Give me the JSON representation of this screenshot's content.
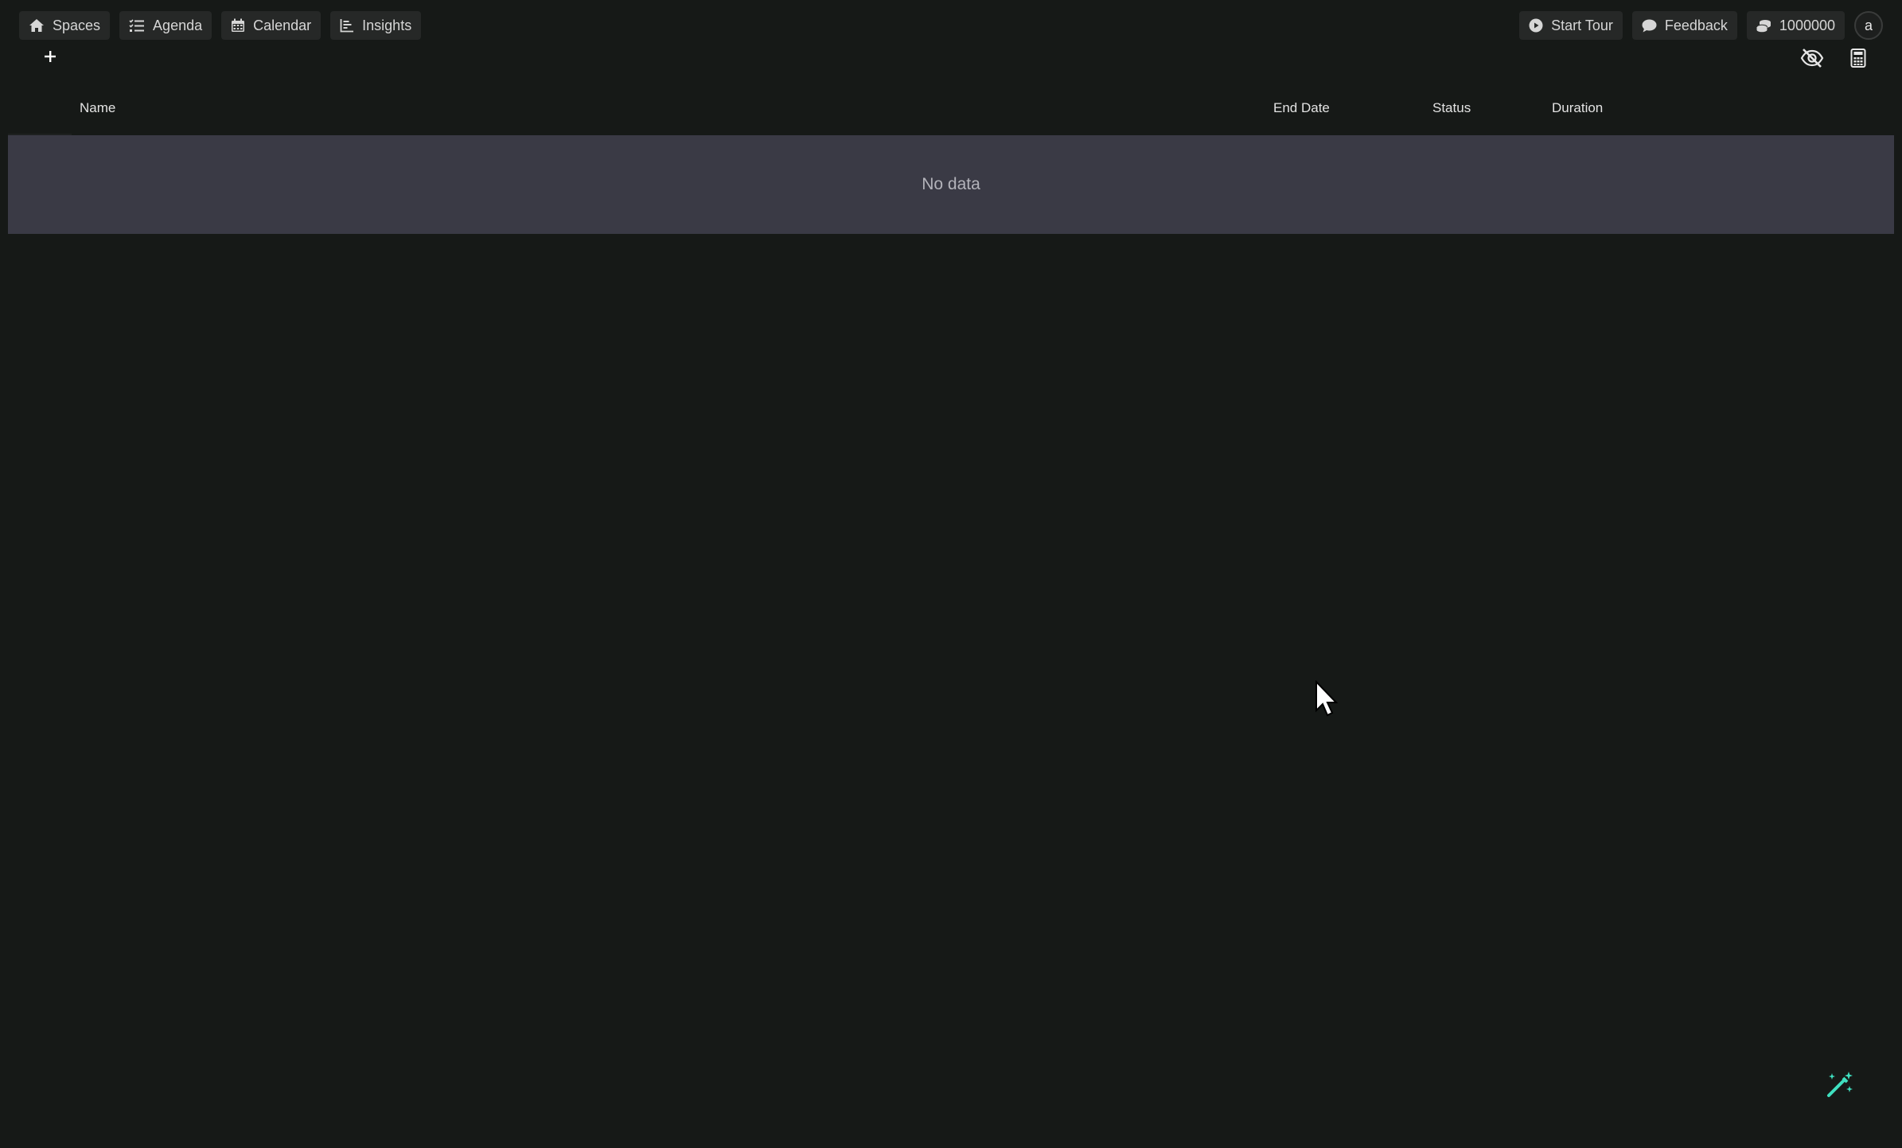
{
  "nav": {
    "spaces": "Spaces",
    "agenda": "Agenda",
    "calendar": "Calendar",
    "insights": "Insights"
  },
  "actions": {
    "start_tour": "Start Tour",
    "feedback": "Feedback",
    "credits": "1000000",
    "avatar_initial": "a"
  },
  "toolbar": {
    "add_icon": "plus-icon",
    "hide_icon": "eye-slash-icon",
    "calculator_icon": "calculator-icon"
  },
  "table": {
    "columns": {
      "name": "Name",
      "end_date": "End Date",
      "status": "Status",
      "duration": "Duration"
    },
    "empty_text": "No data"
  },
  "colors": {
    "background": "#161917",
    "button_bg": "#262827",
    "empty_row_bg": "#3a3a45",
    "accent": "#3fe0c0"
  }
}
